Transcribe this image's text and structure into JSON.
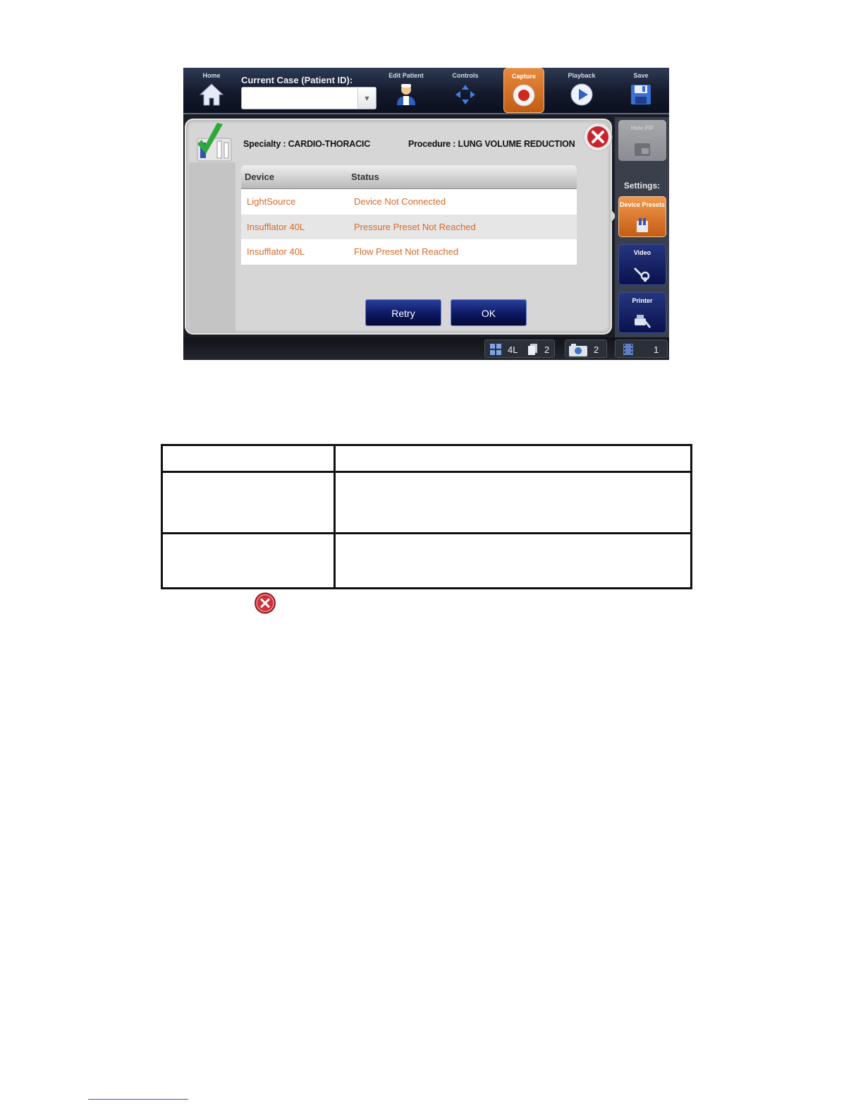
{
  "toolbar": {
    "home_label": "Home",
    "case_label": "Current Case (Patient ID):",
    "case_value": "",
    "edit_patient_label": "Edit Patient",
    "controls_label": "Controls",
    "capture_label": "Capture",
    "playback_label": "Playback",
    "save_label": "Save"
  },
  "dialog": {
    "specialty": "Specialty : CARDIO-THORACIC",
    "procedure": "Procedure : LUNG VOLUME REDUCTION",
    "columns": [
      "Device",
      "Status"
    ],
    "rows": [
      {
        "device": "LightSource",
        "status": "Device Not Connected"
      },
      {
        "device": "Insufflator 40L",
        "status": "Pressure Preset Not Reached"
      },
      {
        "device": "Insufflator 40L",
        "status": "Flow Preset Not Reached"
      }
    ],
    "retry_label": "Retry",
    "ok_label": "OK"
  },
  "sidebar": {
    "pip_label": "Hide PIP",
    "settings_label": "Settings:",
    "device_presets_label": "Device Presets",
    "video_label": "Video",
    "printer_label": "Printer"
  },
  "statusbar": {
    "layout_value": "4L",
    "pages_value": "2",
    "captures_value": "2",
    "videos_value": "1"
  },
  "colors": {
    "accent_orange": "#d8692a",
    "toolbar_dark": "#141a2b",
    "button_blue": "#0c1760"
  }
}
